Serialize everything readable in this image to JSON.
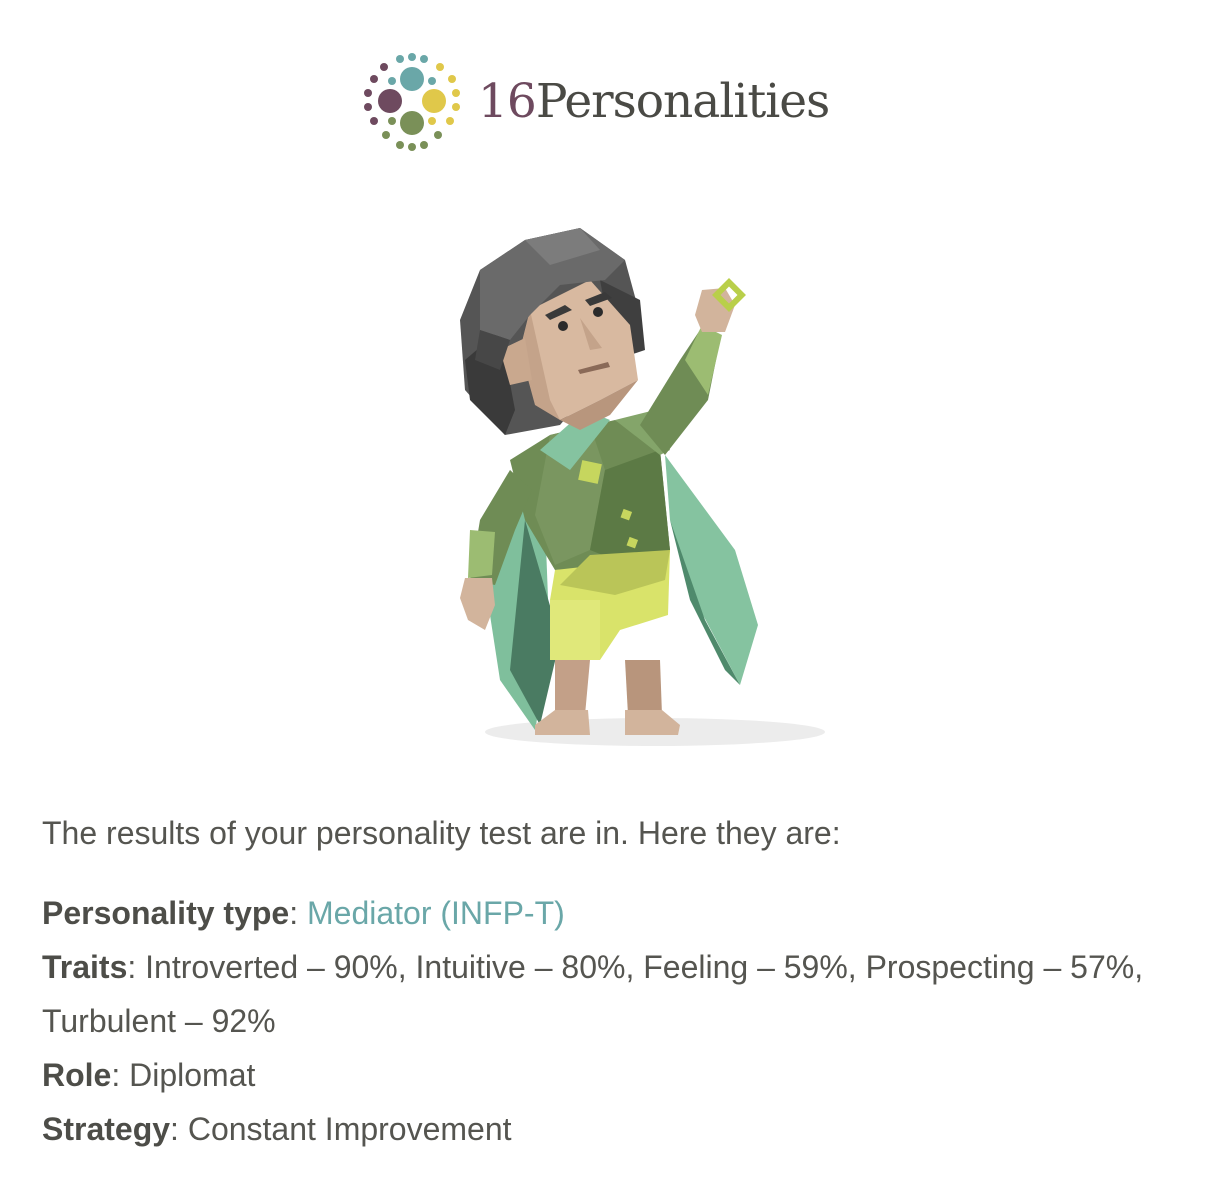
{
  "brand": {
    "number": "16",
    "name": "Personalities",
    "colors": {
      "teal": "#6aa7a8",
      "plum": "#6e4a5f",
      "yellow": "#e0c84a",
      "green": "#7a9058"
    }
  },
  "hero": {
    "icon": "mediator-character-illustration"
  },
  "message": {
    "intro": "The results of your personality test are in. Here they are:",
    "type_label": "Personality type",
    "type_value": "Mediator (INFP-T)",
    "traits_label": "Traits",
    "traits_value": "Introverted – 90%, Intuitive – 80%, Feeling – 59%, Prospecting – 57%, Turbulent – 92%",
    "role_label": "Role",
    "role_value": "Diplomat",
    "strategy_label": "Strategy",
    "strategy_value": "Constant Improvement"
  }
}
